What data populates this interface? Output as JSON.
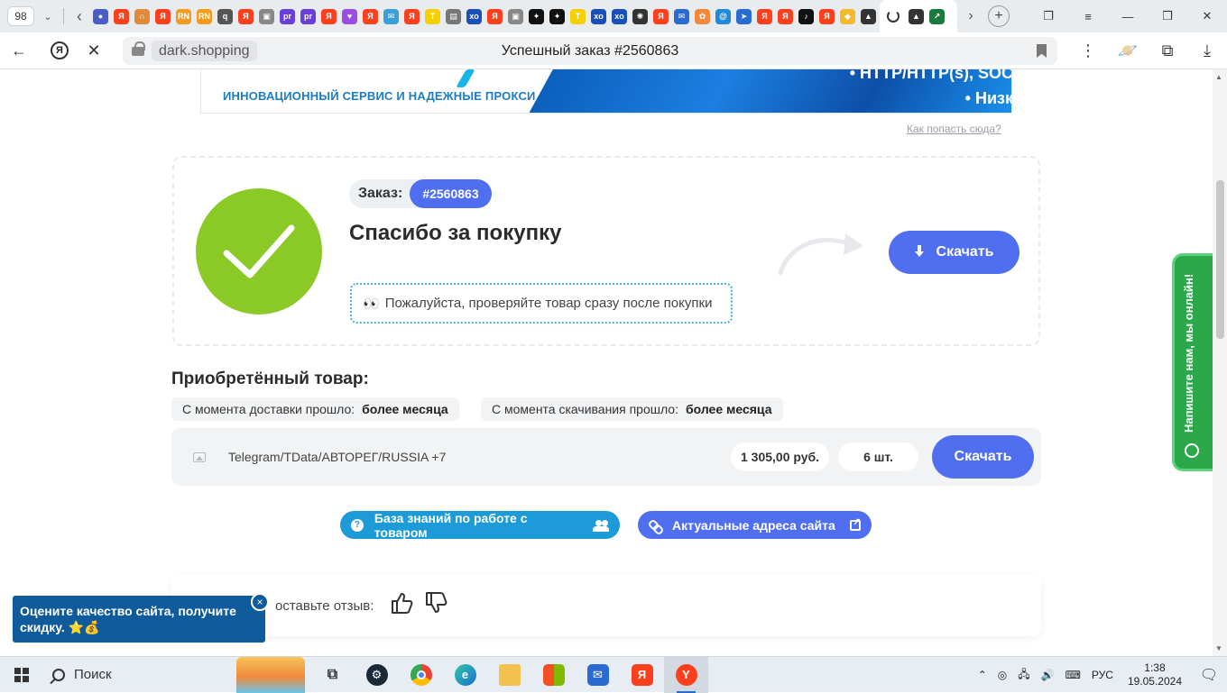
{
  "browser": {
    "tab_count": "98",
    "active_tab_title": "Успешный заказ #2560863",
    "domain": "dark.shopping",
    "favicons": [
      {
        "name": "globe-favicon",
        "color": "#4a5cc7",
        "glyph": "●"
      },
      {
        "name": "yandex-favicon",
        "color": "#fc3f1d",
        "glyph": "Я"
      },
      {
        "name": "arch-favicon",
        "color": "#e08a3c",
        "glyph": "∩"
      },
      {
        "name": "yandex-favicon",
        "color": "#fc3f1d",
        "glyph": "Я"
      },
      {
        "name": "rn-favicon",
        "color": "#f29c1f",
        "glyph": "RN"
      },
      {
        "name": "rn-favicon",
        "color": "#f29c1f",
        "glyph": "RN"
      },
      {
        "name": "q-favicon",
        "color": "#555555",
        "glyph": "q"
      },
      {
        "name": "yandex-favicon",
        "color": "#fc3f1d",
        "glyph": "Я"
      },
      {
        "name": "photo-favicon",
        "color": "#888888",
        "glyph": "▣"
      },
      {
        "name": "pr-favicon",
        "color": "#6a3fd8",
        "glyph": "pr"
      },
      {
        "name": "pr-favicon",
        "color": "#6a3fd8",
        "glyph": "pr"
      },
      {
        "name": "yandex-favicon",
        "color": "#fc3f1d",
        "glyph": "Я"
      },
      {
        "name": "heart-favicon",
        "color": "#9b4de0",
        "glyph": "♥"
      },
      {
        "name": "yandex-favicon",
        "color": "#fc3f1d",
        "glyph": "Я"
      },
      {
        "name": "mail-favicon",
        "color": "#3aa0d8",
        "glyph": "✉"
      },
      {
        "name": "yandex-favicon",
        "color": "#fc3f1d",
        "glyph": "Я"
      },
      {
        "name": "t-favicon",
        "color": "#f5d000",
        "glyph": "T"
      },
      {
        "name": "doc-favicon",
        "color": "#777777",
        "glyph": "▤"
      },
      {
        "name": "xo-favicon",
        "color": "#1b4fb8",
        "glyph": "xo"
      },
      {
        "name": "yandex-favicon",
        "color": "#fc3f1d",
        "glyph": "Я"
      },
      {
        "name": "photo-favicon",
        "color": "#888888",
        "glyph": "▣"
      },
      {
        "name": "star-favicon",
        "color": "#111111",
        "glyph": "✦"
      },
      {
        "name": "star-favicon",
        "color": "#111111",
        "glyph": "✦"
      },
      {
        "name": "t-favicon",
        "color": "#f5d000",
        "glyph": "T"
      },
      {
        "name": "xo-favicon",
        "color": "#1b4fb8",
        "glyph": "xo"
      },
      {
        "name": "xo-favicon",
        "color": "#1b4fb8",
        "glyph": "xo"
      },
      {
        "name": "gear-favicon",
        "color": "#333333",
        "glyph": "✺"
      },
      {
        "name": "yandex-favicon",
        "color": "#fc3f1d",
        "glyph": "Я"
      },
      {
        "name": "mail-favicon",
        "color": "#2a6bd1",
        "glyph": "✉"
      },
      {
        "name": "flower-favicon",
        "color": "#f08a3c",
        "glyph": "✿"
      },
      {
        "name": "at-favicon",
        "color": "#1f8ad8",
        "glyph": "@"
      },
      {
        "name": "arrow-favicon",
        "color": "#2a6bd1",
        "glyph": "➤"
      },
      {
        "name": "yandex-favicon",
        "color": "#fc3f1d",
        "glyph": "Я"
      },
      {
        "name": "yandex-favicon",
        "color": "#fc3f1d",
        "glyph": "Я"
      },
      {
        "name": "tiktok-favicon",
        "color": "#111111",
        "glyph": "♪"
      },
      {
        "name": "yandex-favicon",
        "color": "#fc3f1d",
        "glyph": "Я"
      },
      {
        "name": "binance-favicon",
        "color": "#f3ba2f",
        "glyph": "◆"
      },
      {
        "name": "helmet-favicon",
        "color": "#333333",
        "glyph": "▲"
      }
    ],
    "active_tab_favicons": [
      {
        "name": "helmet-favicon",
        "color": "#333333",
        "glyph": "▲"
      },
      {
        "name": "chart-favicon",
        "color": "#1b7a3e",
        "glyph": "↗"
      }
    ]
  },
  "banner": {
    "tagline": "ИННОВАЦИОННЫЙ СЕРВИС И НАДЕЖНЫЕ ПРОКСИ",
    "line1": "• HTTP/HTTP(s), SOC",
    "line2": "• Низк"
  },
  "ad_link": "Как попасть сюда?",
  "order": {
    "label": "Заказ:",
    "number": "#2560863",
    "thanks": "Спасибо за покупку",
    "notice_emoji": "👀",
    "notice": "Пожалуйста, проверяйте товар сразу после покупки",
    "download_label": "Скачать"
  },
  "purchased": {
    "title": "Приобретённый товар:",
    "delivery_label": "С момента доставки прошло:",
    "delivery_value": "более месяца",
    "download_elapsed_label": "С момента скачивания прошло:",
    "download_elapsed_value": "более месяца",
    "product_name": "Telegram/TData/АВТОРЕГ/RUSSIA +7",
    "price": "1 305,00 руб.",
    "quantity": "6 шт.",
    "download_label": "Скачать"
  },
  "links": {
    "knowledge_base": "База знаний по работе с товаром",
    "site_addresses": "Актуальные адреса сайта"
  },
  "review": {
    "text": "оставьте отзыв:"
  },
  "chat": {
    "label": "Напишите нам, мы онлайн!"
  },
  "promo": {
    "text": "Оцените качество сайта, получите скидку. ⭐💰",
    "close": "×"
  },
  "taskbar": {
    "search_label": "Поиск",
    "lang": "РУС",
    "time": "1:38",
    "date": "19.05.2024"
  },
  "colors": {
    "accent_blue": "#4f6ef0",
    "success_green": "#8ac926",
    "info_blue": "#1c9bd8",
    "chat_green": "#2aa84a",
    "promo_blue": "#0f5b9c"
  }
}
